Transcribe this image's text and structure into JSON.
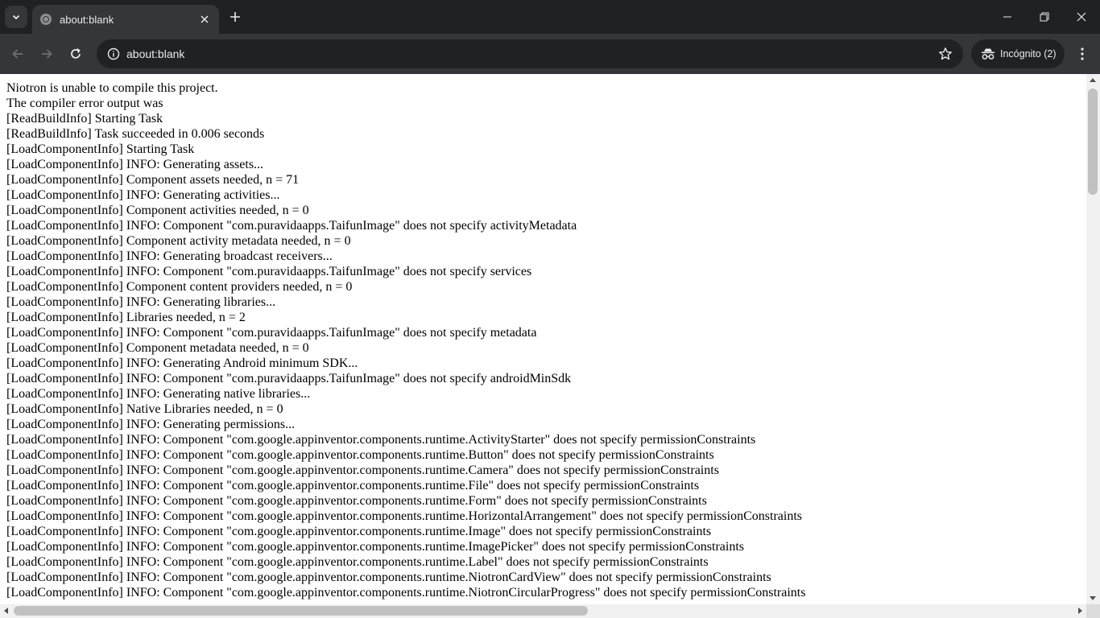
{
  "browser": {
    "tab": {
      "title": "about:blank"
    },
    "address_bar": {
      "url": "about:blank"
    },
    "incognito_label": "Incógnito (2)",
    "colors": {
      "frame": "#202124",
      "toolbar": "#35363a",
      "text": "#e8eaed"
    }
  },
  "page": {
    "lines": [
      "Niotron is unable to compile this project.",
      "The compiler error output was",
      "[ReadBuildInfo] Starting Task",
      "[ReadBuildInfo] Task succeeded in 0.006 seconds",
      "[LoadComponentInfo] Starting Task",
      "[LoadComponentInfo] INFO: Generating assets...",
      "[LoadComponentInfo] Component assets needed, n = 71",
      "[LoadComponentInfo] INFO: Generating activities...",
      "[LoadComponentInfo] Component activities needed, n = 0",
      "[LoadComponentInfo] INFO: Component \"com.puravidaapps.TaifunImage\" does not specify activityMetadata",
      "[LoadComponentInfo] Component activity metadata needed, n = 0",
      "[LoadComponentInfo] INFO: Generating broadcast receivers...",
      "[LoadComponentInfo] INFO: Component \"com.puravidaapps.TaifunImage\" does not specify services",
      "[LoadComponentInfo] Component content providers needed, n = 0",
      "[LoadComponentInfo] INFO: Generating libraries...",
      "[LoadComponentInfo] Libraries needed, n = 2",
      "[LoadComponentInfo] INFO: Component \"com.puravidaapps.TaifunImage\" does not specify metadata",
      "[LoadComponentInfo] Component metadata needed, n = 0",
      "[LoadComponentInfo] INFO: Generating Android minimum SDK...",
      "[LoadComponentInfo] INFO: Component \"com.puravidaapps.TaifunImage\" does not specify androidMinSdk",
      "[LoadComponentInfo] INFO: Generating native libraries...",
      "[LoadComponentInfo] Native Libraries needed, n = 0",
      "[LoadComponentInfo] INFO: Generating permissions...",
      "[LoadComponentInfo] INFO: Component \"com.google.appinventor.components.runtime.ActivityStarter\" does not specify permissionConstraints",
      "[LoadComponentInfo] INFO: Component \"com.google.appinventor.components.runtime.Button\" does not specify permissionConstraints",
      "[LoadComponentInfo] INFO: Component \"com.google.appinventor.components.runtime.Camera\" does not specify permissionConstraints",
      "[LoadComponentInfo] INFO: Component \"com.google.appinventor.components.runtime.File\" does not specify permissionConstraints",
      "[LoadComponentInfo] INFO: Component \"com.google.appinventor.components.runtime.Form\" does not specify permissionConstraints",
      "[LoadComponentInfo] INFO: Component \"com.google.appinventor.components.runtime.HorizontalArrangement\" does not specify permissionConstraints",
      "[LoadComponentInfo] INFO: Component \"com.google.appinventor.components.runtime.Image\" does not specify permissionConstraints",
      "[LoadComponentInfo] INFO: Component \"com.google.appinventor.components.runtime.ImagePicker\" does not specify permissionConstraints",
      "[LoadComponentInfo] INFO: Component \"com.google.appinventor.components.runtime.Label\" does not specify permissionConstraints",
      "[LoadComponentInfo] INFO: Component \"com.google.appinventor.components.runtime.NiotronCardView\" does not specify permissionConstraints",
      "[LoadComponentInfo] INFO: Component \"com.google.appinventor.components.runtime.NiotronCircularProgress\" does not specify permissionConstraints"
    ]
  }
}
